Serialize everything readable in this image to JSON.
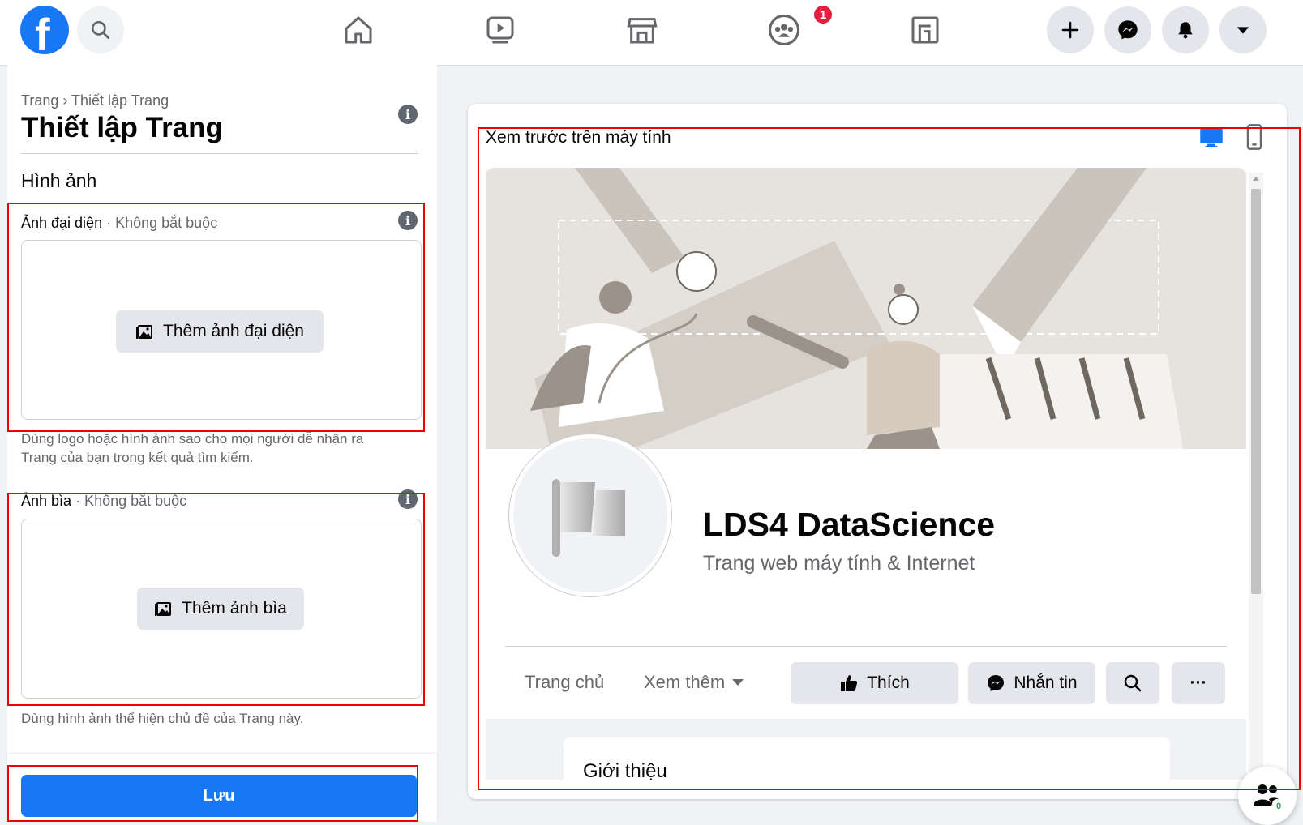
{
  "header": {
    "icons": [
      "facebook-logo",
      "search-icon",
      "home-icon",
      "watch-icon",
      "marketplace-icon",
      "groups-icon",
      "gaming-icon",
      "plus-icon",
      "messenger-icon",
      "bell-icon",
      "caret-down-icon"
    ],
    "groups_badge": "1"
  },
  "left": {
    "breadcrumb": "Trang › Thiết lập Trang",
    "title": "Thiết lập Trang",
    "section": "Hình ảnh",
    "profile_label": "Ảnh đại diện",
    "profile_optional": " · Không bắt buộc",
    "profile_button": "Thêm ảnh đại diện",
    "profile_help_1": "Dùng logo hoặc hình ảnh sao cho mọi người dễ nhận ra",
    "profile_help_2": "Trang của bạn trong kết quả tìm kiếm.",
    "cover_label": "Ảnh bìa",
    "cover_optional": " · Không bắt buộc",
    "cover_button": "Thêm ảnh bìa",
    "cover_help": "Dùng hình ảnh thể hiện chủ đề của Trang này.",
    "save": "Lưu"
  },
  "preview": {
    "title": "Xem trước trên máy tính",
    "page_name": "LDS4 DataScience",
    "category": "Trang web máy tính & Internet",
    "tab_home": "Trang chủ",
    "tab_more": "Xem thêm",
    "like": "Thích",
    "message": "Nhắn tin",
    "more": "···",
    "intro": "Giới thiệu"
  },
  "colors": {
    "accent": "#1877f2",
    "highlight": "#e00000",
    "badge": "#e41e3f"
  },
  "friends_online_count": "0"
}
